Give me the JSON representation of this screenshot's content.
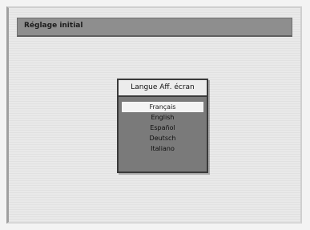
{
  "header": {
    "title": "Réglage initial"
  },
  "language_dialog": {
    "title": "Langue Aff. écran",
    "selected_index": 0,
    "options": [
      {
        "label": "Français"
      },
      {
        "label": "English"
      },
      {
        "label": "Español"
      },
      {
        "label": "Deutsch"
      },
      {
        "label": "Italiano"
      }
    ]
  },
  "colors": {
    "title_bar": "#8e8e8e",
    "dialog_body": "#7a7a7a",
    "selected_row": "#f4f4f4",
    "screen_background": "#e9e9e9"
  }
}
